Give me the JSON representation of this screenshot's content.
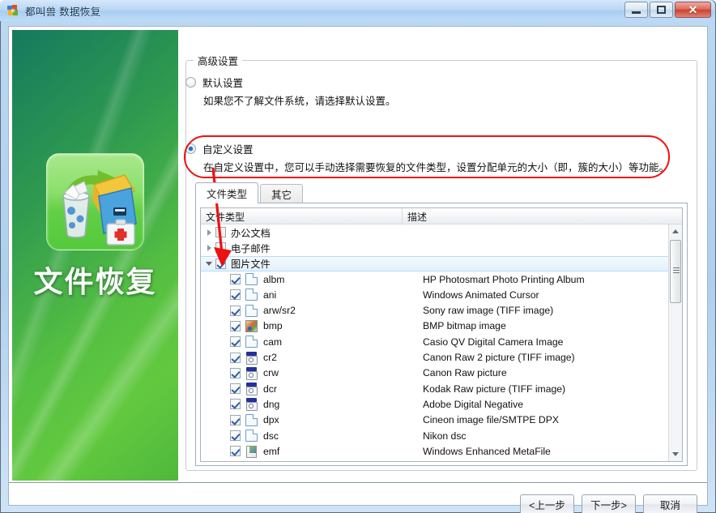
{
  "window": {
    "title": "都叫兽 数据恢复",
    "icon": "app-puzzle-icon",
    "minimize_label": "",
    "maximize_label": "",
    "close_label": "✕"
  },
  "sidebar": {
    "icon": "recycle-bin-recovery-icon",
    "title": "文件恢复"
  },
  "groupbox": {
    "legend": "高级设置"
  },
  "options": {
    "default": {
      "label": "默认设置",
      "description": "如果您不了解文件系统，请选择默认设置。",
      "selected": false
    },
    "custom": {
      "label": "自定义设置",
      "description": "在自定义设置中，您可以手动选择需要恢复的文件类型，设置分配单元的大小（即，簇的大小）等功能。",
      "selected": true
    }
  },
  "annotation": {
    "color": "#ee1111",
    "shape": "rounded-rect-and-arrow"
  },
  "tabs": [
    {
      "label": "文件类型",
      "active": true
    },
    {
      "label": "其它",
      "active": false
    }
  ],
  "list": {
    "columns": [
      "文件类型",
      "描述"
    ],
    "groups": [
      {
        "name": "办公文档",
        "checked": false,
        "expanded": false
      },
      {
        "name": "电子邮件",
        "checked": false,
        "expanded": false
      },
      {
        "name": "图片文件",
        "checked": true,
        "expanded": true,
        "selected": true
      }
    ],
    "rows": [
      {
        "checked": true,
        "icon": "doc",
        "name": "albm",
        "desc": "HP Photosmart Photo Printing Album"
      },
      {
        "checked": true,
        "icon": "doc",
        "name": "ani",
        "desc": "Windows Animated Cursor"
      },
      {
        "checked": true,
        "icon": "doc",
        "name": "arw/sr2",
        "desc": "Sony raw image (TIFF image)"
      },
      {
        "checked": true,
        "icon": "img",
        "name": "bmp",
        "desc": "BMP bitmap image"
      },
      {
        "checked": true,
        "icon": "doc",
        "name": "cam",
        "desc": "Casio QV Digital Camera Image"
      },
      {
        "checked": true,
        "icon": "cam",
        "name": "cr2",
        "desc": "Canon Raw 2 picture (TIFF image)"
      },
      {
        "checked": true,
        "icon": "cam",
        "name": "crw",
        "desc": "Canon Raw picture"
      },
      {
        "checked": true,
        "icon": "cam",
        "name": "dcr",
        "desc": "Kodak Raw picture (TIFF image)"
      },
      {
        "checked": true,
        "icon": "cam",
        "name": "dng",
        "desc": "Adobe Digital Negative"
      },
      {
        "checked": true,
        "icon": "doc",
        "name": "dpx",
        "desc": "Cineon image file/SMTPE DPX"
      },
      {
        "checked": true,
        "icon": "doc",
        "name": "dsc",
        "desc": "Nikon dsc"
      },
      {
        "checked": true,
        "icon": "emf",
        "name": "emf",
        "desc": "Windows Enhanced MetaFile"
      }
    ]
  },
  "footer": {
    "buttons": [
      {
        "label": "<上一步",
        "name": "back-button"
      },
      {
        "label": "下一步>",
        "name": "next-button"
      },
      {
        "label": "取消",
        "name": "cancel-button"
      }
    ]
  }
}
